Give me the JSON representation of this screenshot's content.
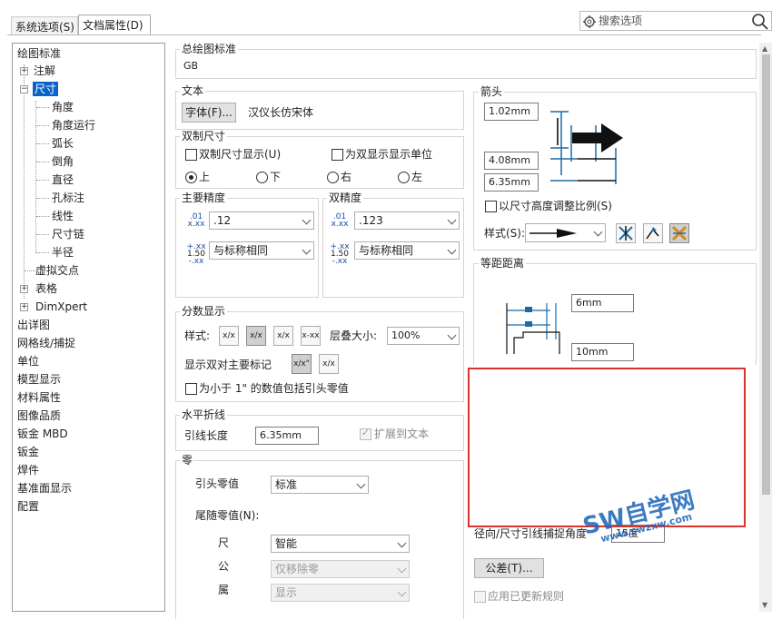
{
  "tabs": [
    {
      "label": "系统选项(S)"
    },
    {
      "label": "文档属性(D)"
    }
  ],
  "search": {
    "placeholder": "搜索选项"
  },
  "tree": [
    {
      "label": "绘图标准"
    },
    {
      "label": "注解"
    },
    {
      "label": "尺寸"
    },
    {
      "label": "角度"
    },
    {
      "label": "角度运行"
    },
    {
      "label": "弧长"
    },
    {
      "label": "倒角"
    },
    {
      "label": "直径"
    },
    {
      "label": "孔标注"
    },
    {
      "label": "线性"
    },
    {
      "label": "尺寸链"
    },
    {
      "label": "半径"
    },
    {
      "label": "虚拟交点"
    },
    {
      "label": "表格"
    },
    {
      "label": "DimXpert"
    },
    {
      "label": "出详图"
    },
    {
      "label": "网格线/捕捉"
    },
    {
      "label": "单位"
    },
    {
      "label": "模型显示"
    },
    {
      "label": "材料属性"
    },
    {
      "label": "图像品质"
    },
    {
      "label": "钣金 MBD"
    },
    {
      "label": "钣金"
    },
    {
      "label": "焊件"
    },
    {
      "label": "基准面显示"
    },
    {
      "label": "配置"
    }
  ],
  "overall": {
    "title": "总绘图标准",
    "value": "GB"
  },
  "text": {
    "title": "文本",
    "font_button": "字体(F)...",
    "font_name": "汉仪长仿宋体"
  },
  "dual": {
    "title": "双制尺寸",
    "show_dual": "双制尺寸显示(U)",
    "show_units": "为双显示显示单位",
    "top": "上",
    "bottom": "下",
    "right": "右",
    "left": "左"
  },
  "primary": {
    "title": "主要精度",
    "value1": ".12",
    "value2": "与标称相同",
    "icon1_top": ".01",
    "icon1_bottom": "x.xx",
    "icon2_top": "+.xx",
    "icon2_mid": "1.50",
    "icon2_bottom": "-.xx"
  },
  "dual_precision": {
    "title": "双精度",
    "value1": ".123",
    "value2": "与标称相同",
    "icon1_top": ".01",
    "icon1_bottom": "x.xx",
    "icon2_top": "+.xx",
    "icon2_mid": "1.50",
    "icon2_bottom": "-.xx"
  },
  "fraction": {
    "title": "分数显示",
    "style_label": "样式:",
    "stack_label": "层叠大小:",
    "stack_value": "100%",
    "dual_label": "显示双对主要标记",
    "leading_zero": "为小于 1\" 的数值包括引头零值",
    "b1": "x/x",
    "b2": "x/x",
    "b3": "x/x",
    "b4": "x-xx",
    "b5": "x/x\"",
    "b6": "x/x"
  },
  "leader": {
    "title": "水平折线",
    "length_label": "引线长度",
    "length_value": "6.35mm",
    "extend": "扩展到文本"
  },
  "zeros": {
    "title": "零",
    "leading_label": "引头零值",
    "leading_value": "标准",
    "trailing_label": "尾随零值(N):",
    "dim_label": "尺",
    "dim_value": "智能",
    "tol_label": "公",
    "tol_value": "仅移除零",
    "prop_label": "属",
    "prop_value": "显示"
  },
  "arrows": {
    "title": "箭头",
    "v1": "1.02mm",
    "v2": "4.08mm",
    "v3": "6.35mm",
    "scale": "以尺寸高度调整比例(S)",
    "style_label": "样式(S):"
  },
  "offset": {
    "title": "等距距离",
    "v1": "6mm",
    "v2": "10mm"
  },
  "radial": {
    "label": "径向/尺寸引线捕捉角度",
    "value": "15度"
  },
  "tolerance_button": "公差(T)...",
  "apply_updated": "应用已更新规则",
  "watermark": {
    "text": "SW自学网",
    "url": "www.swzxw.com"
  },
  "colors": {
    "selection": "#0a64c8",
    "highlight": "#d9342b",
    "diagram": "#1b6aa5"
  }
}
